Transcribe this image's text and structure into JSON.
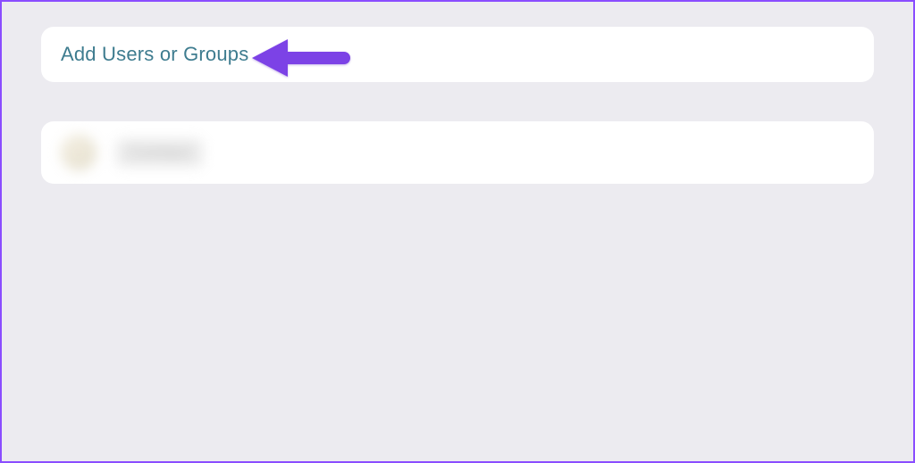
{
  "actions": {
    "add_label": "Add Users or Groups"
  },
  "list": {
    "items": [
      {
        "label": "Contact"
      }
    ]
  },
  "annotation": {
    "arrow_color": "#7b43e6"
  }
}
